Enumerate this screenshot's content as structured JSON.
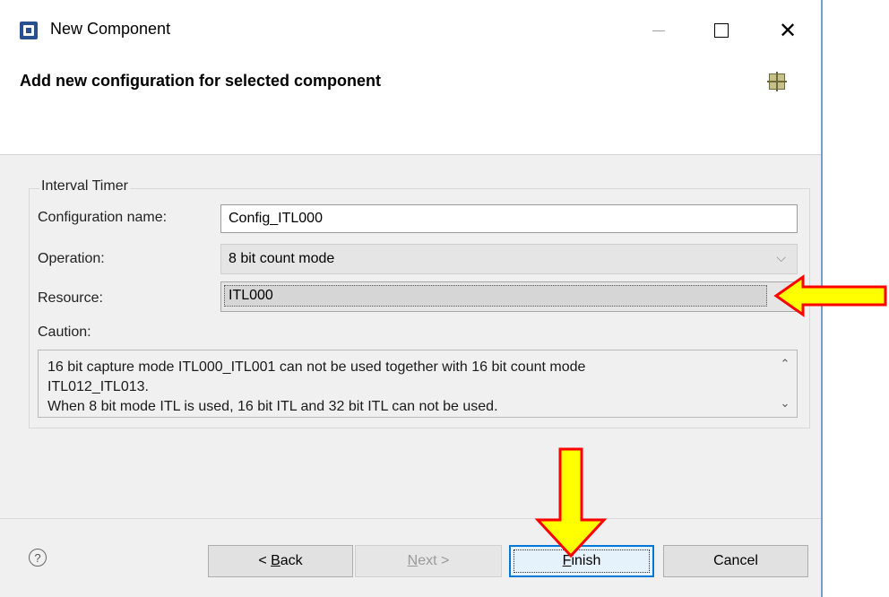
{
  "window": {
    "title": "New Component",
    "icon": "component-app-icon",
    "controls": {
      "minimize": "minimize-icon",
      "maximize": "maximize-icon",
      "close": "close-icon",
      "close_glyph": "✕"
    }
  },
  "banner": {
    "title": "Add new configuration for selected component",
    "icon": "component-grid-icon"
  },
  "group": {
    "label": "Interval Timer",
    "config_name_label": "Configuration name:",
    "config_name_value": "Config_ITL000",
    "operation_label": "Operation:",
    "operation_value": "8 bit count mode",
    "resource_label": "Resource:",
    "resource_value": "ITL000",
    "caution_label": "Caution:",
    "caution_text": "16 bit capture mode ITL000_ITL001 can not be used together with 16 bit count mode\nITL012_ITL013.\nWhen 8 bit mode ITL is used, 16 bit ITL and 32 bit ITL can not be used."
  },
  "icons": {
    "chevron": "⌵",
    "scroll_up": "⌃",
    "scroll_down": "⌄",
    "help": "?"
  },
  "footer": {
    "back_prefix": "< ",
    "back_mnemonic": "B",
    "back_rest": "ack",
    "next_mnemonic": "N",
    "next_rest": "ext >",
    "finish_mnemonic": "F",
    "finish_rest": "inish",
    "cancel_label": "Cancel"
  },
  "colors": {
    "annotation_fill": "#ffff00",
    "annotation_stroke": "#ff0000",
    "focus_blue": "#0078d7"
  }
}
